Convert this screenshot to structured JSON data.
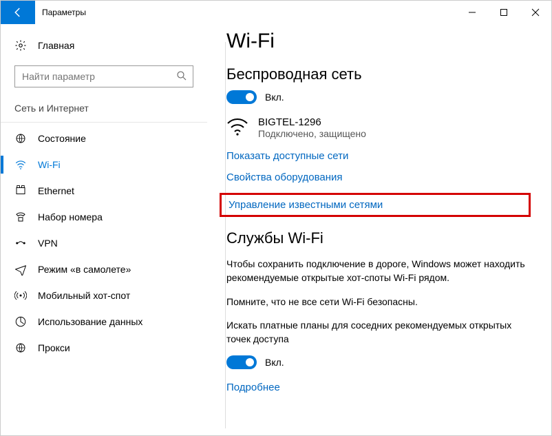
{
  "titlebar": {
    "title": "Параметры"
  },
  "sidebar": {
    "home": "Главная",
    "search_placeholder": "Найти параметр",
    "group": "Сеть и Интернет",
    "items": [
      {
        "label": "Состояние"
      },
      {
        "label": "Wi-Fi"
      },
      {
        "label": "Ethernet"
      },
      {
        "label": "Набор номера"
      },
      {
        "label": "VPN"
      },
      {
        "label": "Режим «в самолете»"
      },
      {
        "label": "Мобильный хот-спот"
      },
      {
        "label": "Использование данных"
      },
      {
        "label": "Прокси"
      }
    ]
  },
  "content": {
    "heading": "Wi-Fi",
    "wireless_title": "Беспроводная сеть",
    "wireless_toggle": "Вкл.",
    "ssid": "BIGTEL-1296",
    "ssid_status": "Подключено, защищено",
    "link_show": "Показать доступные сети",
    "link_hw": "Свойства оборудования",
    "link_known": "Управление известными сетями",
    "services_title": "Службы Wi-Fi",
    "services_para1": "Чтобы сохранить подключение в дороге, Windows может находить рекомендуемые открытые хот-споты Wi-Fi рядом.",
    "services_para2": "Помните, что не все сети Wi-Fi безопасны.",
    "services_para3": "Искать платные планы для соседних рекомендуемых открытых точек доступа",
    "services_toggle": "Вкл.",
    "link_more": "Подробнее"
  }
}
